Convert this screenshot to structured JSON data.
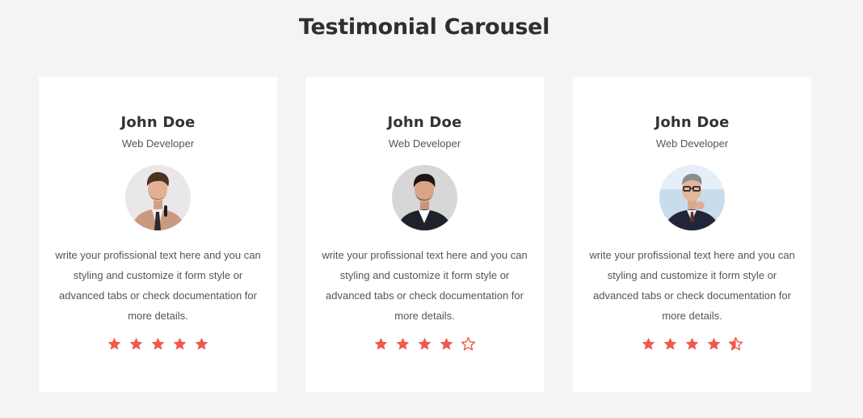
{
  "page": {
    "title": "Testimonial Carousel"
  },
  "colors": {
    "background": "#f4f4f4",
    "card": "#ffffff",
    "star": "#ef5a4c"
  },
  "testimonials": [
    {
      "name": "John Doe",
      "role": "Web Developer",
      "avatar": "man-beige-suit-photo",
      "text": "write your profissional text here and you can styling and customize it form style or advanced tabs or check documentation for more details.",
      "rating": 5,
      "stars": [
        "star-full-icon",
        "star-full-icon",
        "star-full-icon",
        "star-full-icon",
        "star-full-icon"
      ]
    },
    {
      "name": "John Doe",
      "role": "Web Developer",
      "avatar": "man-dark-suit-photo",
      "text": "write your profissional text here and you can styling and customize it form style or advanced tabs or check documentation for more details.",
      "rating": 4,
      "stars": [
        "star-full-icon",
        "star-full-icon",
        "star-full-icon",
        "star-full-icon",
        "star-empty-icon"
      ]
    },
    {
      "name": "John Doe",
      "role": "Web Developer",
      "avatar": "man-glasses-photo",
      "text": "write your profissional text here and you can styling and customize it form style or advanced tabs or check documentation for more details.",
      "rating": 4.5,
      "stars": [
        "star-full-icon",
        "star-full-icon",
        "star-full-icon",
        "star-full-icon",
        "star-half-icon"
      ]
    }
  ]
}
